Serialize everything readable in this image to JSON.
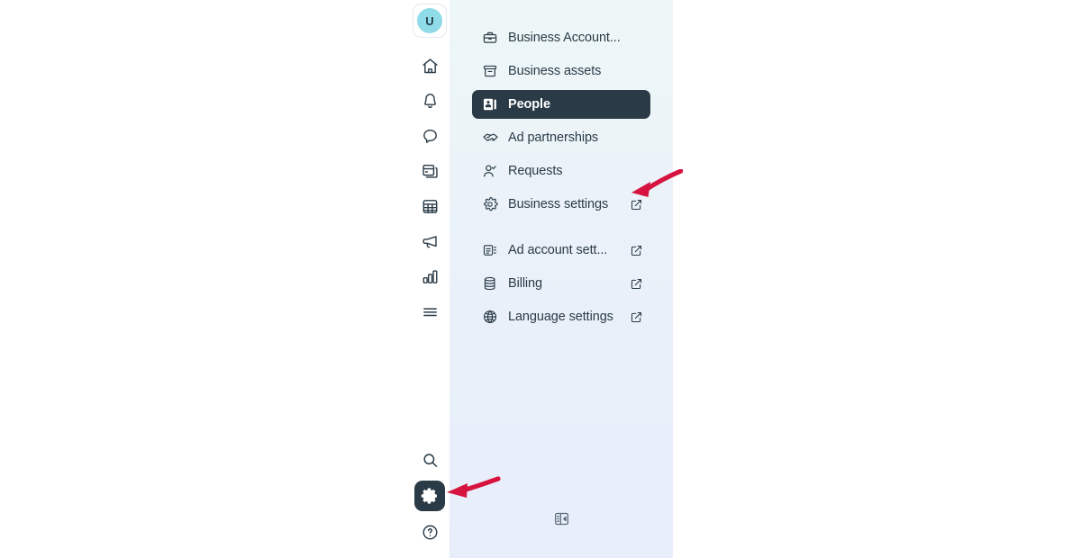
{
  "rail": {
    "avatar": {
      "initial": "U",
      "name": "user-avatar",
      "bg": "#8fdbe8"
    },
    "icons": [
      {
        "name": "home-icon",
        "label": "Home"
      },
      {
        "name": "bell-icon",
        "label": "Notifications"
      },
      {
        "name": "chat-bubble-icon",
        "label": "Messages"
      },
      {
        "name": "pages-icon",
        "label": "Posts"
      },
      {
        "name": "grid-table-icon",
        "label": "Content"
      },
      {
        "name": "megaphone-icon",
        "label": "Ads"
      },
      {
        "name": "bar-chart-icon",
        "label": "Analytics"
      },
      {
        "name": "hamburger-menu-icon",
        "label": "More"
      }
    ],
    "bottom_icons": [
      {
        "name": "search-icon",
        "label": "Search",
        "active": false
      },
      {
        "name": "gear-icon",
        "label": "Settings",
        "active": true
      },
      {
        "name": "help-circle-icon",
        "label": "Help",
        "active": false
      }
    ]
  },
  "panel": {
    "groups": [
      {
        "items": [
          {
            "label": "Business Account...",
            "icon": "briefcase-icon",
            "external": false,
            "active": false
          },
          {
            "label": "Business assets",
            "icon": "archive-box-icon",
            "external": false,
            "active": false
          },
          {
            "label": "People",
            "icon": "id-badge-icon",
            "external": false,
            "active": true
          },
          {
            "label": "Ad partnerships",
            "icon": "handshake-icon",
            "external": false,
            "active": false
          },
          {
            "label": "Requests",
            "icon": "person-check-icon",
            "external": false,
            "active": false
          },
          {
            "label": "Business settings",
            "icon": "gear-icon",
            "external": true,
            "active": false
          }
        ]
      },
      {
        "items": [
          {
            "label": "Ad account sett...",
            "icon": "ad-account-icon",
            "external": true,
            "active": false
          },
          {
            "label": "Billing",
            "icon": "coins-stack-icon",
            "external": true,
            "active": false
          },
          {
            "label": "Language settings",
            "icon": "globe-icon",
            "external": true,
            "active": false
          }
        ]
      }
    ],
    "footer": {
      "icon": "collapse-panel-icon",
      "label": "Collapse panel"
    }
  },
  "annotations": {
    "color": "#d6143f",
    "arrows": [
      {
        "name": "arrow-to-business-settings",
        "target": "Business settings"
      },
      {
        "name": "arrow-to-settings-gear",
        "target": "Settings"
      }
    ]
  },
  "colors": {
    "panel_bg_top": "#eef7f7",
    "panel_bg_bottom": "#e7eefa",
    "active_item_bg": "#2a3b47",
    "text": "#2a3b47",
    "accent_red": "#d6143f",
    "avatar_bg": "#8fdbe8"
  }
}
